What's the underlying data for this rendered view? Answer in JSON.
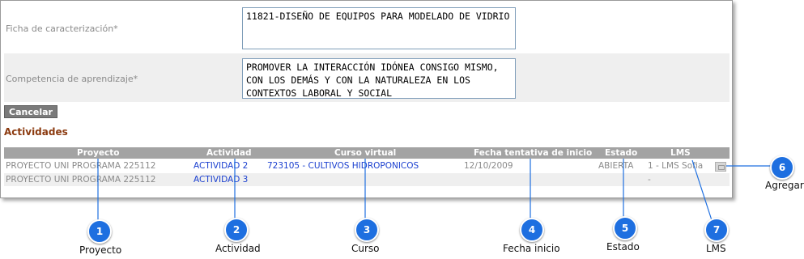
{
  "form": {
    "ficha_label": "Ficha de caracterización*",
    "ficha_value": "11821-DISEÑO DE EQUIPOS PARA MODELADO DE VIDRIO",
    "competencia_label": "Competencia de aprendizaje*",
    "competencia_value": "PROMOVER LA INTERACCIÓN IDÓNEA CONSIGO MISMO,\nCON LOS DEMÁS Y CON LA NATURALEZA EN LOS\nCONTEXTOS LABORAL Y SOCIAL",
    "cancel_label": "Cancelar"
  },
  "activities": {
    "title": "Actividades",
    "columns": [
      "Proyecto",
      "Actividad",
      "Curso virtual",
      "Fecha tentativa de inicio",
      "Estado",
      "LMS"
    ],
    "rows": [
      {
        "proyecto": "PROYECTO UNI PROGRAMA 225112",
        "actividad": "ACTIVIDAD 2",
        "curso": "723105 - CULTIVOS HIDROPONICOS",
        "fecha": "12/10/2009",
        "estado": "ABIERTA",
        "lms": "1 - LMS Sofia"
      },
      {
        "proyecto": "PROYECTO UNI PROGRAMA 225112",
        "actividad": "ACTIVIDAD 3",
        "curso": "",
        "fecha": "",
        "estado": "",
        "lms": "-"
      }
    ]
  },
  "callouts": [
    {
      "num": "1",
      "label": "Proyecto"
    },
    {
      "num": "2",
      "label": "Actividad"
    },
    {
      "num": "3",
      "label": "Curso"
    },
    {
      "num": "4",
      "label": "Fecha inicio"
    },
    {
      "num": "5",
      "label": "Estado"
    },
    {
      "num": "6",
      "label": "Agregar"
    },
    {
      "num": "7",
      "label": "LMS"
    }
  ],
  "colors": {
    "callout": "#1e6fe0",
    "link": "#1a3fcf",
    "section_title": "#8b3a0f"
  }
}
